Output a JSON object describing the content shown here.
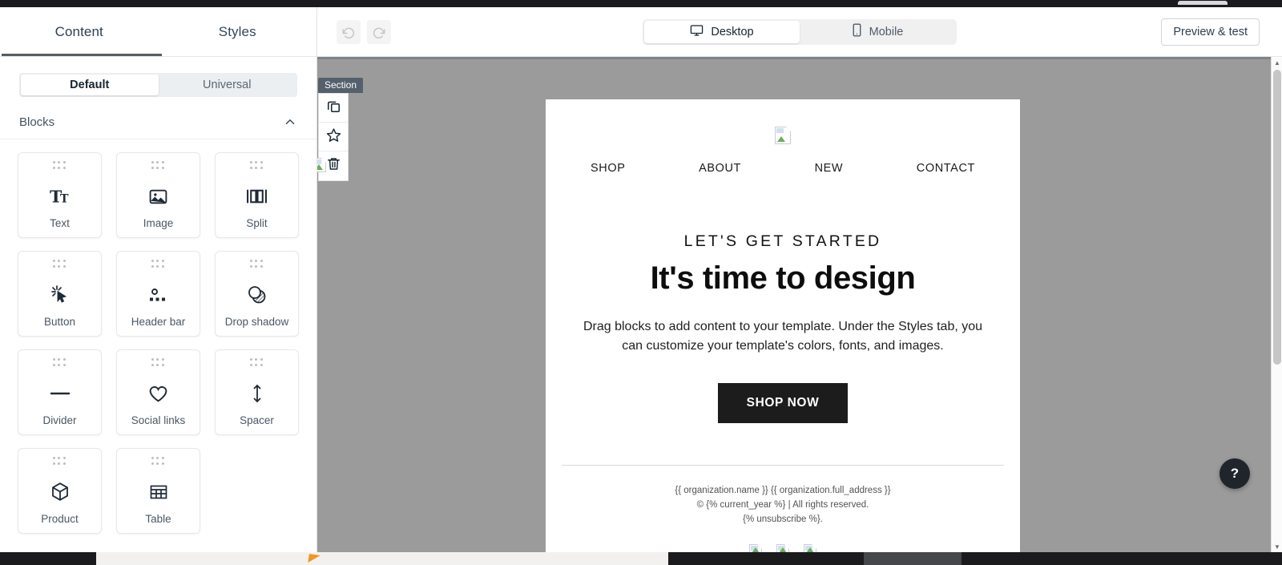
{
  "sidebar": {
    "tabs": [
      {
        "label": "Content",
        "active": true
      },
      {
        "label": "Styles",
        "active": false
      }
    ],
    "segment": [
      {
        "label": "Default",
        "active": true
      },
      {
        "label": "Universal",
        "active": false
      }
    ],
    "blocks_section": {
      "title": "Blocks",
      "collapse_icon": "chevron-up-icon"
    },
    "blocks": [
      {
        "label": "Text",
        "icon": "text-icon"
      },
      {
        "label": "Image",
        "icon": "image-icon"
      },
      {
        "label": "Split",
        "icon": "split-icon"
      },
      {
        "label": "Button",
        "icon": "button-click-icon"
      },
      {
        "label": "Header bar",
        "icon": "header-bar-icon"
      },
      {
        "label": "Drop shadow",
        "icon": "drop-shadow-icon"
      },
      {
        "label": "Divider",
        "icon": "divider-icon"
      },
      {
        "label": "Social links",
        "icon": "heart-icon"
      },
      {
        "label": "Spacer",
        "icon": "vertical-arrows-icon"
      },
      {
        "label": "Product",
        "icon": "cube-icon"
      },
      {
        "label": "Table",
        "icon": "table-icon"
      }
    ]
  },
  "toolbar": {
    "undo_icon": "undo-icon",
    "redo_icon": "redo-icon",
    "devices": [
      {
        "label": "Desktop",
        "icon": "monitor-icon",
        "active": true
      },
      {
        "label": "Mobile",
        "icon": "phone-icon",
        "active": false
      }
    ],
    "preview_label": "Preview & test"
  },
  "canvas": {
    "section_badge": "Section",
    "section_tools": [
      {
        "name": "duplicate",
        "icon": "copy-icon"
      },
      {
        "name": "favorite",
        "icon": "star-icon"
      },
      {
        "name": "delete",
        "icon": "trash-icon"
      }
    ]
  },
  "email": {
    "logo_alt": "broken-image",
    "nav": [
      "SHOP",
      "ABOUT",
      "NEW",
      "CONTACT"
    ],
    "eyebrow": "LET'S GET STARTED",
    "headline": "It's time to design",
    "body": "Drag blocks to add content to your template. Under the Styles tab, you can customize your template's colors, fonts, and images.",
    "cta_label": "SHOP NOW",
    "footer_line1": "{{ organization.name }} {{ organization.full_address }}",
    "footer_line2": "© {% current_year %} | All rights reserved.",
    "footer_line3": "{% unsubscribe %}.",
    "social_count": 3
  },
  "help": {
    "label": "?"
  },
  "colors": {
    "canvas_grey": "#9b9b9b",
    "section_badge": "#54606c",
    "cta_bg": "#1c1c1c",
    "accent_underline": "#555d66"
  }
}
